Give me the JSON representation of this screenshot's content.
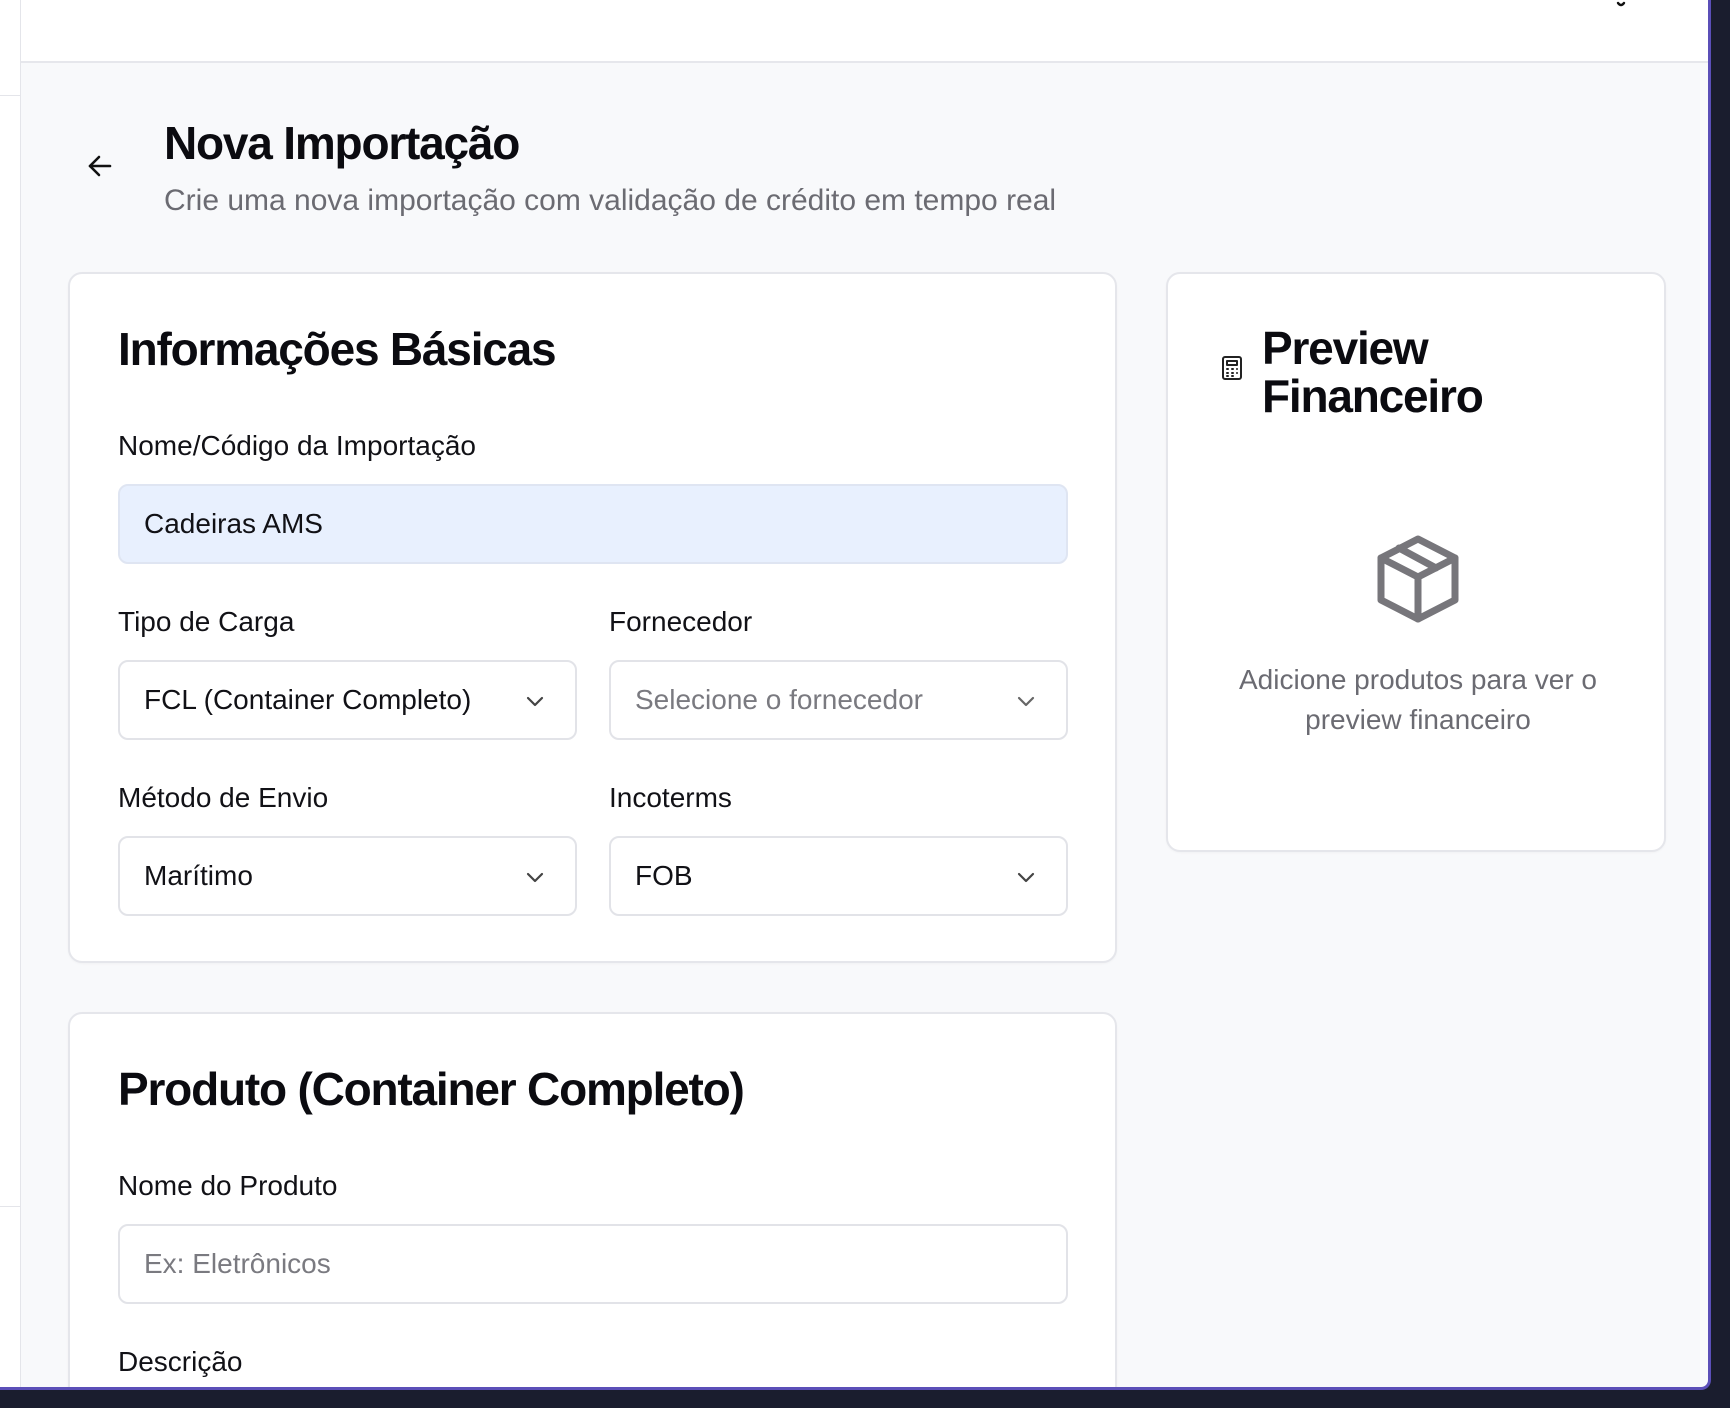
{
  "page": {
    "title": "Nova Importação",
    "subtitle": "Crie uma nova importação com validação de crédito em tempo real"
  },
  "basic_info": {
    "title": "Informações Básicas",
    "name_label": "Nome/Código da Importação",
    "name_value": "Cadeiras AMS",
    "cargo_type_label": "Tipo de Carga",
    "cargo_type_value": "FCL (Container Completo)",
    "supplier_label": "Fornecedor",
    "supplier_placeholder": "Selecione o fornecedor",
    "shipping_method_label": "Método de Envio",
    "shipping_method_value": "Marítimo",
    "incoterms_label": "Incoterms",
    "incoterms_value": "FOB"
  },
  "product": {
    "title": "Produto (Container Completo)",
    "name_label": "Nome do Produto",
    "name_placeholder": "Ex: Eletrônicos",
    "description_label": "Descrição"
  },
  "preview": {
    "title": "Preview Financeiro",
    "empty_message": "Adicione produtos para ver o preview financeiro",
    "icon": "calculator-icon",
    "empty_icon": "package-icon"
  },
  "icons": {
    "back": "arrow-left-icon",
    "notifications": "bell-icon"
  }
}
